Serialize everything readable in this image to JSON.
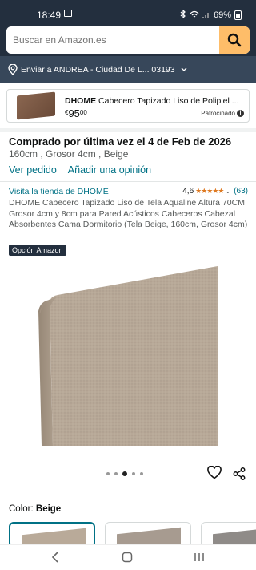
{
  "status_bar": {
    "time": "18:49",
    "battery": "69%"
  },
  "search": {
    "placeholder": "Buscar en Amazon.es"
  },
  "delivery": {
    "text": "Enviar a ANDREA - Ciudad De L... 03193"
  },
  "sponsored_ad": {
    "brand": "DHOME",
    "title": "Cabecero Tapizado Liso de Polipiel ...",
    "price_currency": "€",
    "price_whole": "95",
    "price_fraction": "00",
    "sponsored_label": "Patrocinado"
  },
  "purchase_info": {
    "headline": "Comprado por última vez el 4 de Feb de 2026",
    "variant": "160cm , Grosor 4cm , Beige",
    "view_order": "Ver pedido",
    "add_review": "Añadir una opinión"
  },
  "product": {
    "store_link": "Visita la tienda de DHOME",
    "rating_value": "4,6",
    "rating_stars": 4.6,
    "rating_count": "(63)",
    "title": "DHOME Cabecero Tapizado Liso de Tela Aqualine Altura 70CM Grosor 4cm y 8cm para Pared Acústicos Cabeceros Cabezal Absorbentes Cama Dormitorio (Tela Beige, 160cm, Grosor 4cm)",
    "badge": "Opción Amazon",
    "image_count": 5,
    "image_index": 3
  },
  "color": {
    "label": "Color:",
    "value": "Beige"
  },
  "colors": {
    "beige": "#b8a898",
    "amazon_dark": "#232f3e",
    "link": "#007185",
    "search_button": "#febd69",
    "star": "#de7921"
  }
}
